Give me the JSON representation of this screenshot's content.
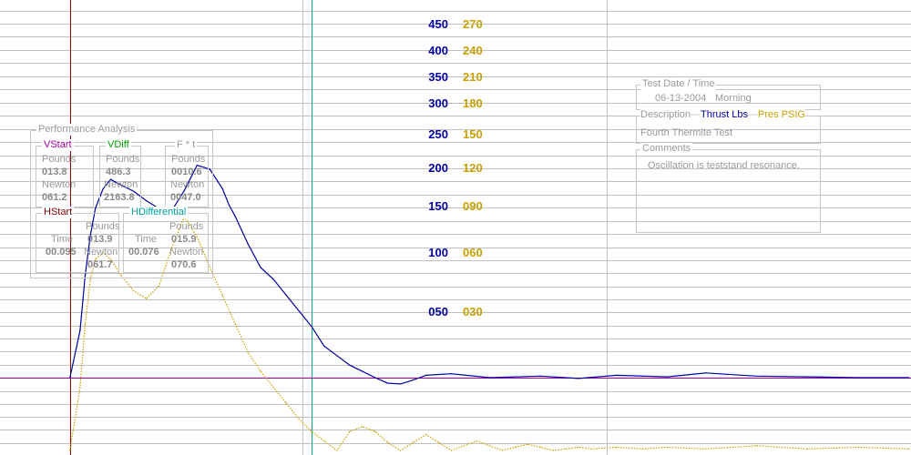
{
  "chart_data": {
    "type": "line",
    "title": "",
    "xlabel": "",
    "series": [
      {
        "name": "Thrust Lbs",
        "color": "#0000a0",
        "axis": "left",
        "x": [
          0.0,
          0.008,
          0.012,
          0.016,
          0.02,
          0.026,
          0.032,
          0.04,
          0.05,
          0.06,
          0.07,
          0.08,
          0.09,
          0.1,
          0.11,
          0.12,
          0.125,
          0.13,
          0.14,
          0.15,
          0.16,
          0.17,
          0.18,
          0.19,
          0.2,
          0.21,
          0.22,
          0.23,
          0.24,
          0.25,
          0.26,
          0.27,
          0.275,
          0.28,
          0.3,
          0.33,
          0.37,
          0.4,
          0.43,
          0.47,
          0.5,
          0.54,
          0.58,
          0.62,
          0.66
        ],
        "values": [
          0,
          60,
          130,
          180,
          215,
          240,
          252,
          245,
          237,
          225,
          215,
          212,
          238,
          270,
          265,
          240,
          220,
          205,
          170,
          140,
          125,
          105,
          85,
          65,
          40,
          28,
          16,
          8,
          0,
          -7,
          -8,
          -3,
          0,
          3,
          5,
          0,
          2,
          -1,
          3,
          1,
          6,
          2,
          1,
          0,
          0
        ]
      },
      {
        "name": "Pres PSIG",
        "color": "#c8a000",
        "axis": "right",
        "x": [
          0.0,
          0.008,
          0.012,
          0.016,
          0.02,
          0.026,
          0.032,
          0.04,
          0.05,
          0.06,
          0.07,
          0.08,
          0.09,
          0.1,
          0.11,
          0.12,
          0.13,
          0.14,
          0.15,
          0.16,
          0.17,
          0.18,
          0.19,
          0.2,
          0.21,
          0.22,
          0.23,
          0.24,
          0.25,
          0.26,
          0.27,
          0.28,
          0.29,
          0.3,
          0.31,
          0.32,
          0.33,
          0.34,
          0.35,
          0.36,
          0.37,
          0.38,
          0.39,
          0.4,
          0.41,
          0.43,
          0.45,
          0.47,
          0.5,
          0.54,
          0.58,
          0.62,
          0.66
        ],
        "values": [
          0,
          40,
          80,
          108,
          121,
          125,
          121,
          111,
          101,
          96,
          104,
          128,
          148,
          135,
          116,
          98,
          80,
          62,
          50,
          40,
          30,
          20,
          12,
          6,
          0,
          12,
          15,
          12,
          5,
          0,
          5,
          10,
          5,
          0,
          3,
          6,
          3,
          0,
          2,
          4,
          2,
          0,
          1,
          2,
          1,
          2,
          1,
          2,
          1,
          3,
          1,
          2,
          1
        ]
      }
    ],
    "left_axis": {
      "name": "Thrust Lbs",
      "ticks": [
        "450",
        "400",
        "350",
        "300",
        "250",
        "200",
        "150",
        "100",
        "050"
      ],
      "ylim": [
        0,
        450
      ]
    },
    "right_axis": {
      "name": "Pres PSIG",
      "ticks": [
        "270",
        "240",
        "210",
        "180",
        "150",
        "120",
        "090",
        "060",
        "030"
      ],
      "ylim": [
        0,
        270
      ]
    },
    "x_range": [
      -0.055,
      0.66
    ],
    "markers": {
      "start_vertical": 0.0,
      "differential_vertical": 0.19,
      "horizontal_level": 0
    },
    "grid": true,
    "colors": {
      "thrust": "#0000a0",
      "pressure": "#c8a000",
      "start_marker": "#800000",
      "diff_marker": "#00a0a0",
      "horizontal_marker": "#a000a0",
      "grid": "#c0c0c0"
    }
  },
  "performance": {
    "title": "Performance Analysis",
    "vstart": {
      "title": "VStart",
      "pounds_label": "Pounds",
      "pounds": "013.8",
      "newton_label": "Newton",
      "newton": "061.2"
    },
    "vdiff": {
      "title": "VDiff",
      "pounds_label": "Pounds",
      "pounds": "486.3",
      "newton_label": "Newton",
      "newton": "2163.8"
    },
    "fxt": {
      "title": "F * t",
      "pounds_label": "Pounds",
      "pounds": "0010.6",
      "newton_label": "Newton",
      "newton": "0047.0"
    },
    "hstart": {
      "title": "HStart",
      "time_label": "Time",
      "time": "00.095",
      "pounds_label": "Pounds",
      "pounds": "013.9",
      "newton_label": "Newton",
      "newton": "061.7"
    },
    "hdiff": {
      "title": "HDifferential",
      "time_label": "Time",
      "time": "00.076",
      "pounds_label": "Pounds",
      "pounds": "015.9",
      "newton_label": "Newton",
      "newton": "070.6"
    }
  },
  "test_date": {
    "title": "Test Date / Time",
    "date": "06-13-2004",
    "time": "Morning"
  },
  "description": {
    "title": "Description",
    "thrust_label": "Thrust Lbs",
    "pres_label": "Pres PSIG",
    "text": "Fourth Thermite Test"
  },
  "comments": {
    "title": "Comments",
    "text": "Oscillation is teststand resonance."
  }
}
